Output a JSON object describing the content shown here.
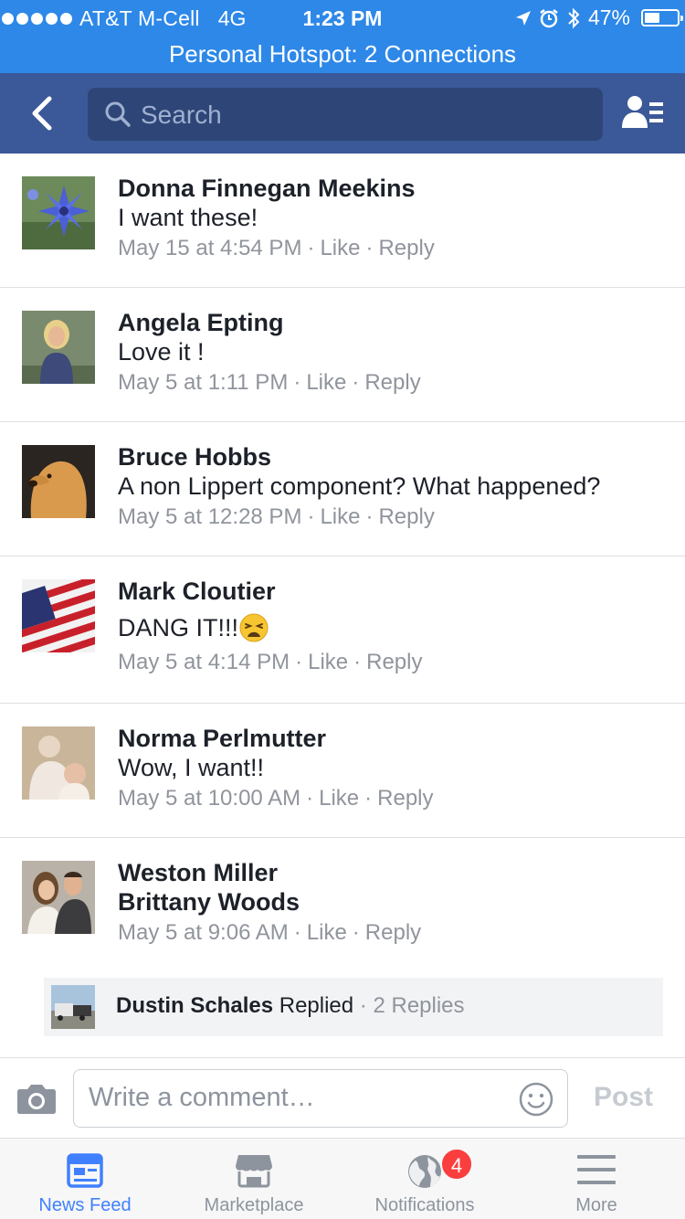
{
  "status_bar": {
    "carrier": "AT&T M-Cell",
    "network": "4G",
    "time": "1:23 PM",
    "battery": "47%",
    "battery_level": 0.47,
    "hotspot": "Personal Hotspot: 2 Connections"
  },
  "nav": {
    "search_placeholder": "Search"
  },
  "comments": [
    {
      "name": "Donna Finnegan Meekins",
      "text": "I want these!",
      "time": "May 15 at 4:54 PM",
      "like": "Like",
      "reply": "Reply"
    },
    {
      "name": "Angela Epting",
      "text": "Love it !",
      "time": "May 5 at 1:11 PM",
      "like": "Like",
      "reply": "Reply"
    },
    {
      "name": "Bruce Hobbs",
      "text": "A non Lippert component?  What happened?",
      "time": "May 5 at 12:28 PM",
      "like": "Like",
      "reply": "Reply"
    },
    {
      "name": "Mark Cloutier",
      "text": "DANG IT!!!",
      "time": "May 5 at 4:14 PM",
      "like": "Like",
      "reply": "Reply"
    },
    {
      "name": "Norma Perlmutter",
      "text": "Wow, I want!!",
      "time": "May 5 at 10:00 AM",
      "like": "Like",
      "reply": "Reply"
    },
    {
      "name": "Weston Miller",
      "text": "Brittany Woods",
      "time": "May 5 at 9:06 AM",
      "like": "Like",
      "reply": "Reply"
    }
  ],
  "reply_summary": {
    "name": "Dustin Schales",
    "action": "Replied",
    "count": "2 Replies"
  },
  "composer": {
    "placeholder": "Write a comment…",
    "post_label": "Post"
  },
  "tabs": [
    {
      "label": "News Feed",
      "icon": "news-feed-icon",
      "active": true
    },
    {
      "label": "Marketplace",
      "icon": "marketplace-icon",
      "active": false
    },
    {
      "label": "Notifications",
      "icon": "globe-icon",
      "badge": "4",
      "active": false
    },
    {
      "label": "More",
      "icon": "menu-icon",
      "active": false
    }
  ],
  "colors": {
    "status_bar": "#2d88e8",
    "nav_bar": "#3b5998",
    "active_tab": "#4080ff",
    "badge": "#fa3e3e"
  }
}
